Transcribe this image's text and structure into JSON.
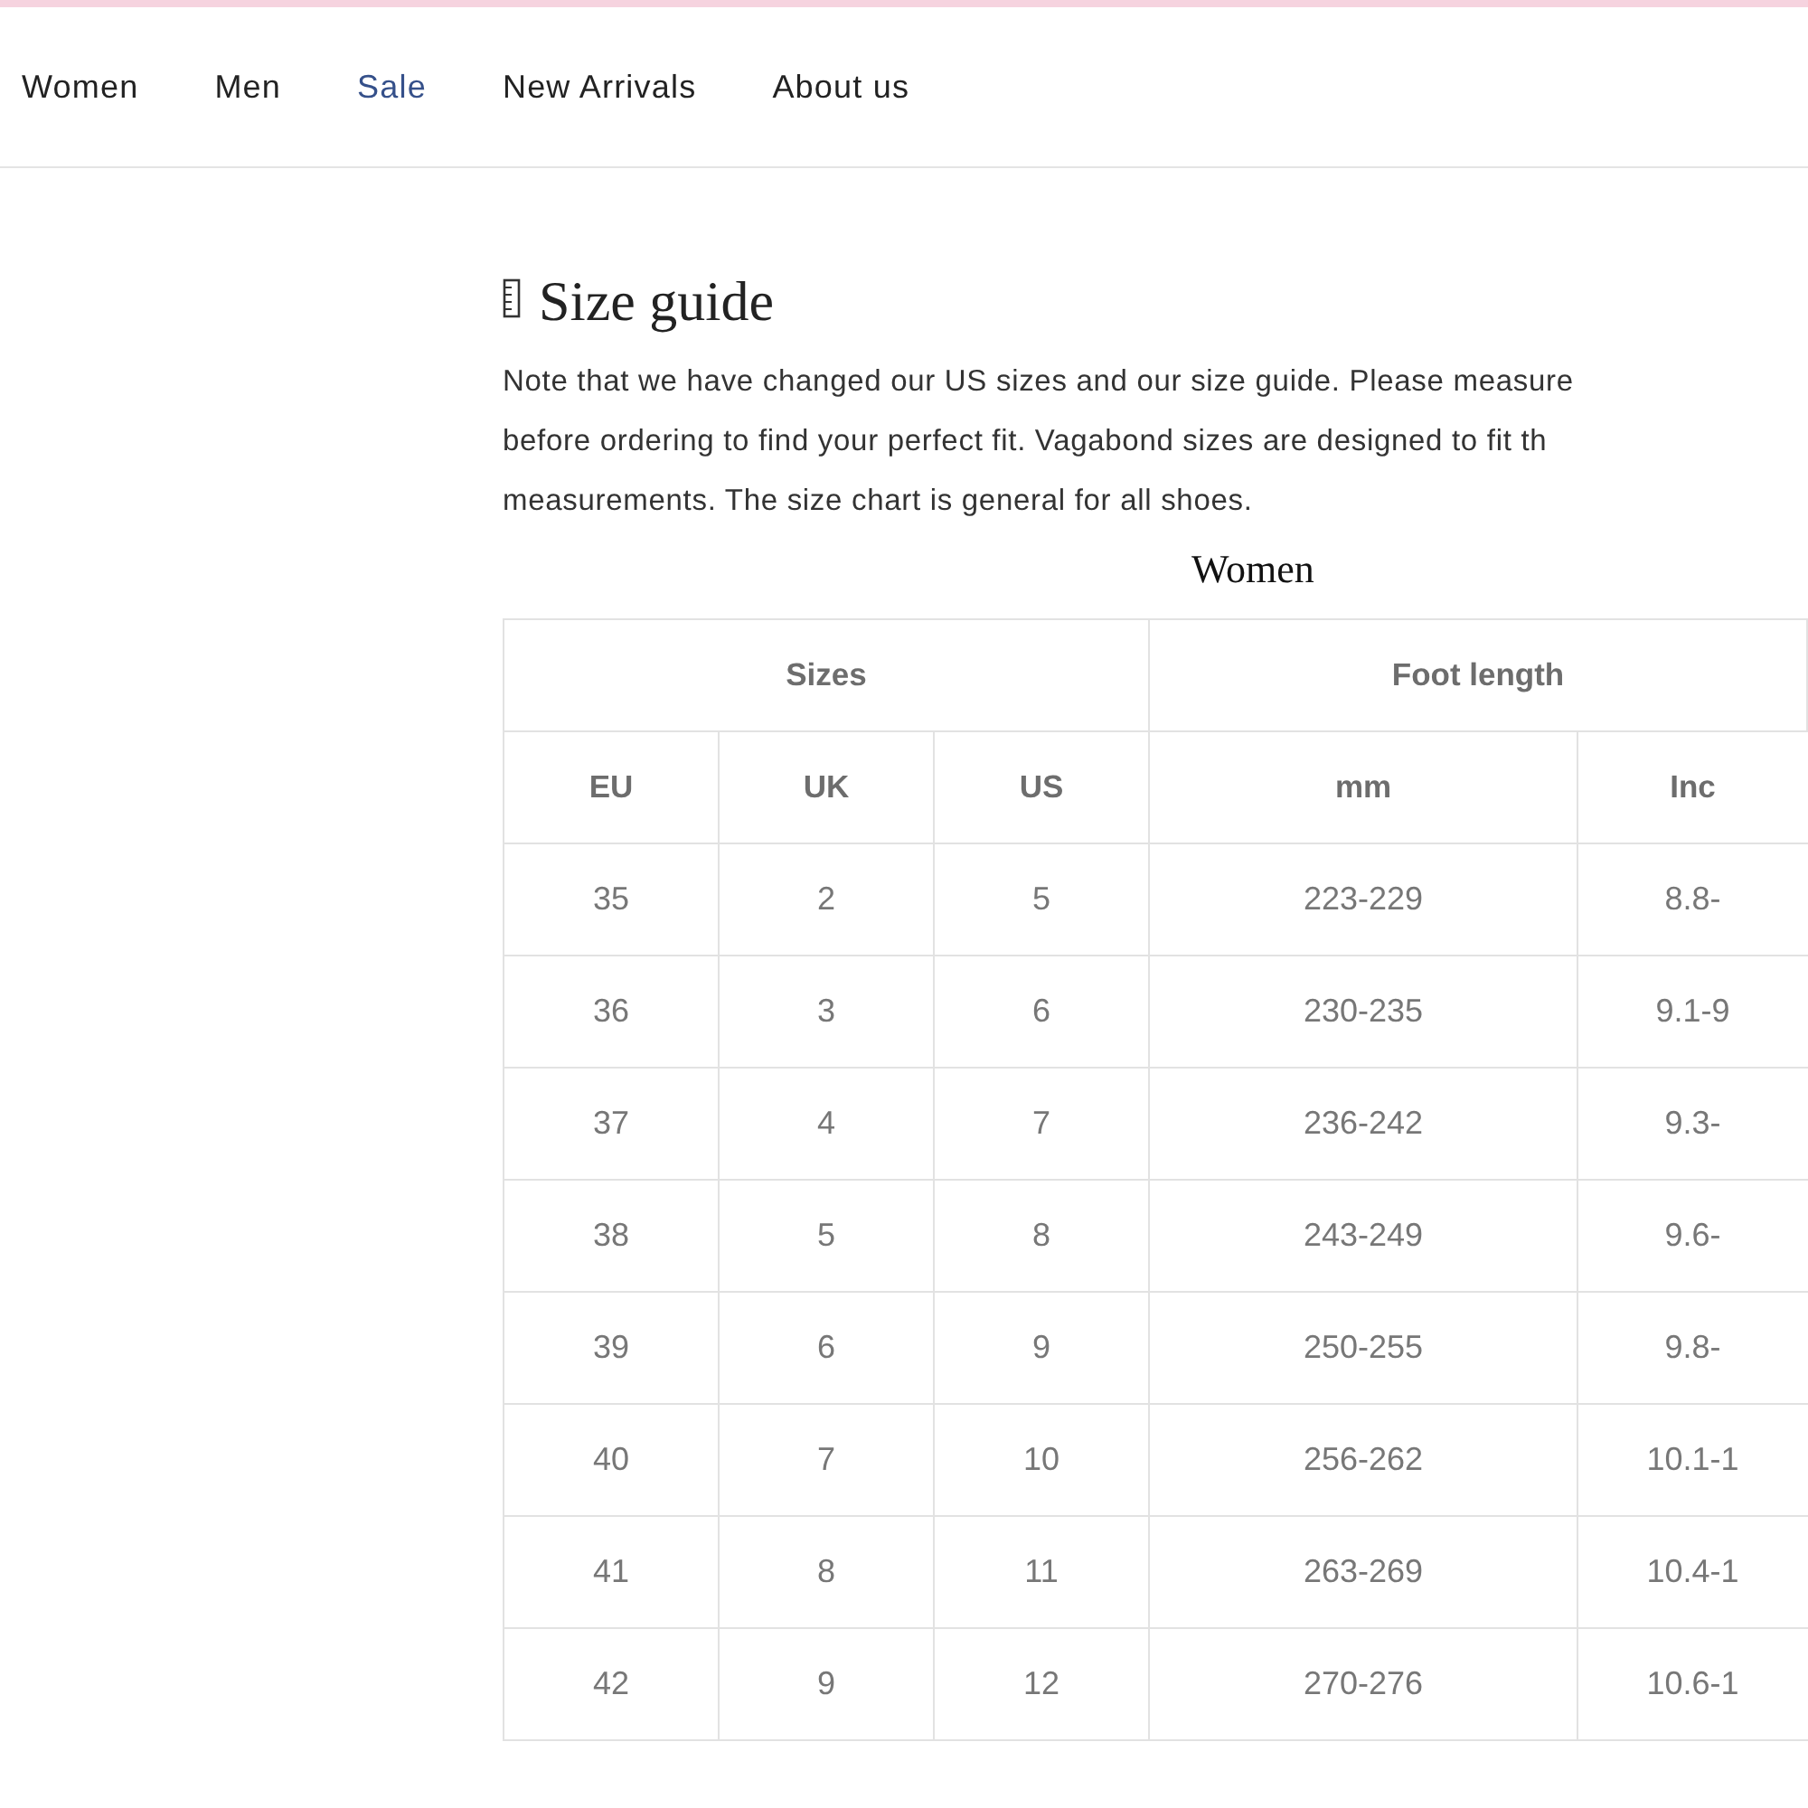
{
  "nav": {
    "items": [
      {
        "label": "Women",
        "selected": false
      },
      {
        "label": "Men",
        "selected": false
      },
      {
        "label": "Sale",
        "selected": true
      },
      {
        "label": "New Arrivals",
        "selected": false
      },
      {
        "label": "About us",
        "selected": false
      }
    ]
  },
  "size_guide": {
    "title": "Size guide",
    "note_lines": [
      "Note that we have changed our US sizes and our size guide. Please measure",
      "before ordering to find your perfect fit. Vagabond sizes are designed to fit th",
      "measurements. The size chart is general for all shoes."
    ],
    "table_title": "Women",
    "groups": [
      "Sizes",
      "Foot length"
    ],
    "columns": [
      "EU",
      "UK",
      "US",
      "mm",
      "Inc"
    ],
    "rows": [
      [
        "35",
        "2",
        "5",
        "223-229",
        "8.8-"
      ],
      [
        "36",
        "3",
        "6",
        "230-235",
        "9.1-9"
      ],
      [
        "37",
        "4",
        "7",
        "236-242",
        "9.3-"
      ],
      [
        "38",
        "5",
        "8",
        "243-249",
        "9.6-"
      ],
      [
        "39",
        "6",
        "9",
        "250-255",
        "9.8-"
      ],
      [
        "40",
        "7",
        "10",
        "256-262",
        "10.1-1"
      ],
      [
        "41",
        "8",
        "11",
        "263-269",
        "10.4-1"
      ],
      [
        "42",
        "9",
        "12",
        "270-276",
        "10.6-1"
      ]
    ]
  }
}
